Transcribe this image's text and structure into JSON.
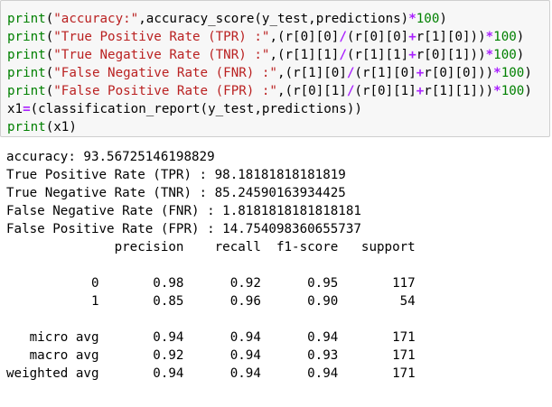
{
  "code_cell": {
    "lines": [
      {
        "tokens": [
          {
            "t": "fn",
            "v": "print"
          },
          {
            "t": "plain",
            "v": "("
          },
          {
            "t": "str",
            "v": "\"accuracy:\""
          },
          {
            "t": "plain",
            "v": ",accuracy_score(y_test,predictions)"
          },
          {
            "t": "op",
            "v": "*"
          },
          {
            "t": "num",
            "v": "100"
          },
          {
            "t": "plain",
            "v": ")"
          }
        ]
      },
      {
        "tokens": [
          {
            "t": "fn",
            "v": "print"
          },
          {
            "t": "plain",
            "v": "("
          },
          {
            "t": "str",
            "v": "\"True Positive Rate (TPR) :\""
          },
          {
            "t": "plain",
            "v": ",(r[0][0]"
          },
          {
            "t": "op",
            "v": "/"
          },
          {
            "t": "plain",
            "v": "(r[0][0]"
          },
          {
            "t": "op",
            "v": "+"
          },
          {
            "t": "plain",
            "v": "r[1][0]))"
          },
          {
            "t": "op",
            "v": "*"
          },
          {
            "t": "num",
            "v": "100"
          },
          {
            "t": "plain",
            "v": ")"
          }
        ]
      },
      {
        "tokens": [
          {
            "t": "fn",
            "v": "print"
          },
          {
            "t": "plain",
            "v": "("
          },
          {
            "t": "str",
            "v": "\"True Negative Rate (TNR) :\""
          },
          {
            "t": "plain",
            "v": ",(r[1][1]"
          },
          {
            "t": "op",
            "v": "/"
          },
          {
            "t": "plain",
            "v": "(r[1][1]"
          },
          {
            "t": "op",
            "v": "+"
          },
          {
            "t": "plain",
            "v": "r[0][1]))"
          },
          {
            "t": "op",
            "v": "*"
          },
          {
            "t": "num",
            "v": "100"
          },
          {
            "t": "plain",
            "v": ")"
          }
        ]
      },
      {
        "tokens": [
          {
            "t": "fn",
            "v": "print"
          },
          {
            "t": "plain",
            "v": "("
          },
          {
            "t": "str",
            "v": "\"False Negative Rate (FNR) :\""
          },
          {
            "t": "plain",
            "v": ",(r[1][0]"
          },
          {
            "t": "op",
            "v": "/"
          },
          {
            "t": "plain",
            "v": "(r[1][0]"
          },
          {
            "t": "op",
            "v": "+"
          },
          {
            "t": "plain",
            "v": "r[0][0]))"
          },
          {
            "t": "op",
            "v": "*"
          },
          {
            "t": "num",
            "v": "100"
          },
          {
            "t": "plain",
            "v": ")"
          }
        ]
      },
      {
        "tokens": [
          {
            "t": "fn",
            "v": "print"
          },
          {
            "t": "plain",
            "v": "("
          },
          {
            "t": "str",
            "v": "\"False Positive Rate (FPR) :\""
          },
          {
            "t": "plain",
            "v": ",(r[0][1]"
          },
          {
            "t": "op",
            "v": "/"
          },
          {
            "t": "plain",
            "v": "(r[0][1]"
          },
          {
            "t": "op",
            "v": "+"
          },
          {
            "t": "plain",
            "v": "r[1][1]))"
          },
          {
            "t": "op",
            "v": "*"
          },
          {
            "t": "num",
            "v": "100"
          },
          {
            "t": "plain",
            "v": ")"
          }
        ]
      },
      {
        "tokens": [
          {
            "t": "plain",
            "v": "x1"
          },
          {
            "t": "op",
            "v": "="
          },
          {
            "t": "plain",
            "v": "(classification_report(y_test,predictions))"
          }
        ]
      },
      {
        "tokens": [
          {
            "t": "fn",
            "v": "print"
          },
          {
            "t": "plain",
            "v": "(x1)"
          }
        ]
      }
    ]
  },
  "output": {
    "lines": [
      "accuracy: 93.56725146198829",
      "True Positive Rate (TPR) : 98.18181818181819",
      "True Negative Rate (TNR) : 85.24590163934425",
      "False Negative Rate (FNR) : 1.8181818181818181",
      "False Positive Rate (FPR) : 14.754098360655737",
      "              precision    recall  f1-score   support",
      "",
      "           0       0.98      0.92      0.95       117",
      "           1       0.85      0.96      0.90        54",
      "",
      "   micro avg       0.94      0.94      0.94       171",
      "   macro avg       0.92      0.94      0.93       171",
      "weighted avg       0.94      0.94      0.94       171"
    ]
  },
  "colors": {
    "cell_background": "#f7f7f7",
    "cell_border": "#cfcfcf",
    "builtin": "#008000",
    "string": "#ba2121",
    "operator": "#aa22ff",
    "number": "#008000"
  }
}
